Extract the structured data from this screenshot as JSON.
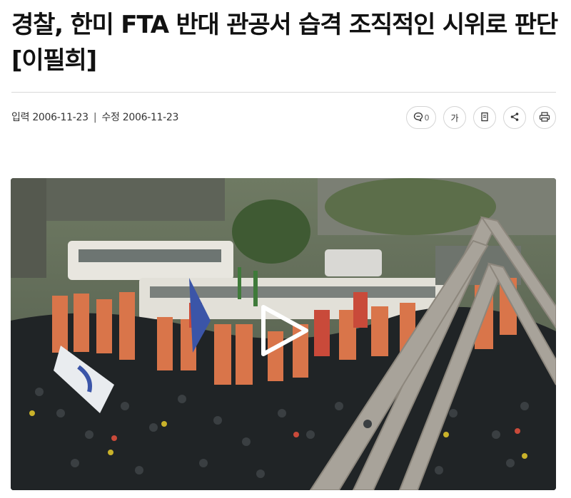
{
  "article": {
    "headline": "경찰, 한미 FTA 반대 관공서 습격 조직적인 시위로 판단[이필희]",
    "meta": {
      "published_label": "입력",
      "published_date": "2006-11-23",
      "separator": "|",
      "updated_label": "수정",
      "updated_date": "2006-11-23"
    }
  },
  "toolbar": {
    "comment_count": "0",
    "font_size_label": "가",
    "icons": [
      "comment-icon",
      "font-size-icon",
      "bookmark-icon",
      "share-icon",
      "print-icon"
    ]
  },
  "video": {
    "play_icon": "play-icon"
  },
  "colors": {
    "divider": "#d9d9d9",
    "icon_border": "#d4d4d4",
    "banner_orange": "#d9754a",
    "banner_red": "#c94a3a",
    "flag_blue": "#3b55a8"
  }
}
